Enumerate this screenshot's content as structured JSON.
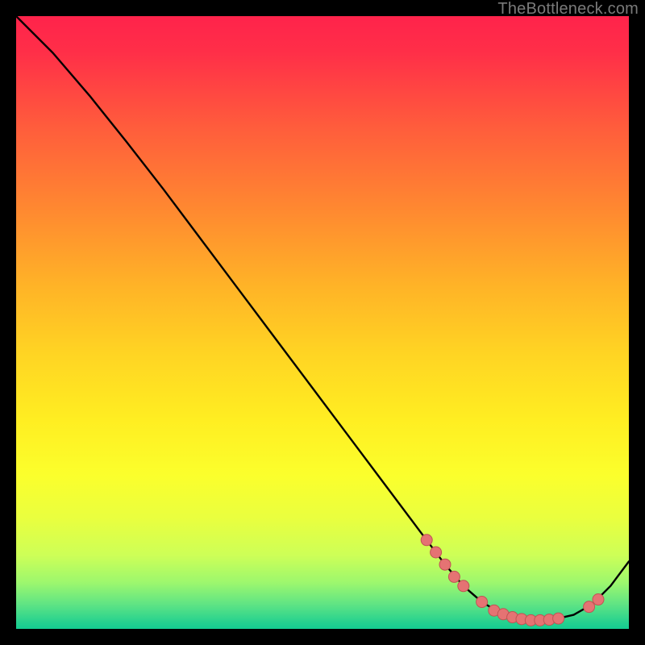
{
  "attribution": "TheBottleneck.com",
  "colors": {
    "curve": "#000000",
    "marker_fill": "#e57373",
    "marker_stroke": "#c05454",
    "gradient_top": "#ff234b",
    "gradient_bottom": "#14cd91",
    "page_bg": "#000000"
  },
  "chart_data": {
    "type": "line",
    "title": "",
    "xlabel": "",
    "ylabel": "",
    "xlim": [
      0,
      100
    ],
    "ylim": [
      0,
      100
    ],
    "legend": false,
    "grid": false,
    "series": [
      {
        "name": "curve",
        "x": [
          0,
          6,
          12,
          18,
          24,
          30,
          36,
          42,
          48,
          54,
          60,
          66,
          70,
          73,
          76,
          79,
          82,
          85,
          88,
          91,
          94,
          97,
          100
        ],
        "y": [
          100,
          94,
          87,
          79.5,
          71.8,
          63.8,
          55.8,
          47.8,
          39.8,
          31.8,
          23.8,
          15.8,
          10.5,
          7.0,
          4.4,
          2.6,
          1.7,
          1.4,
          1.6,
          2.3,
          4.0,
          7.0,
          11.0
        ]
      }
    ],
    "markers": [
      {
        "x": 67.0,
        "y": 14.5
      },
      {
        "x": 68.5,
        "y": 12.5
      },
      {
        "x": 70.0,
        "y": 10.5
      },
      {
        "x": 71.5,
        "y": 8.5
      },
      {
        "x": 73.0,
        "y": 7.0
      },
      {
        "x": 76.0,
        "y": 4.4
      },
      {
        "x": 78.0,
        "y": 3.0
      },
      {
        "x": 79.5,
        "y": 2.4
      },
      {
        "x": 81.0,
        "y": 1.9
      },
      {
        "x": 82.5,
        "y": 1.6
      },
      {
        "x": 84.0,
        "y": 1.4
      },
      {
        "x": 85.5,
        "y": 1.4
      },
      {
        "x": 87.0,
        "y": 1.5
      },
      {
        "x": 88.5,
        "y": 1.7
      },
      {
        "x": 93.5,
        "y": 3.6
      },
      {
        "x": 95.0,
        "y": 4.8
      }
    ]
  }
}
